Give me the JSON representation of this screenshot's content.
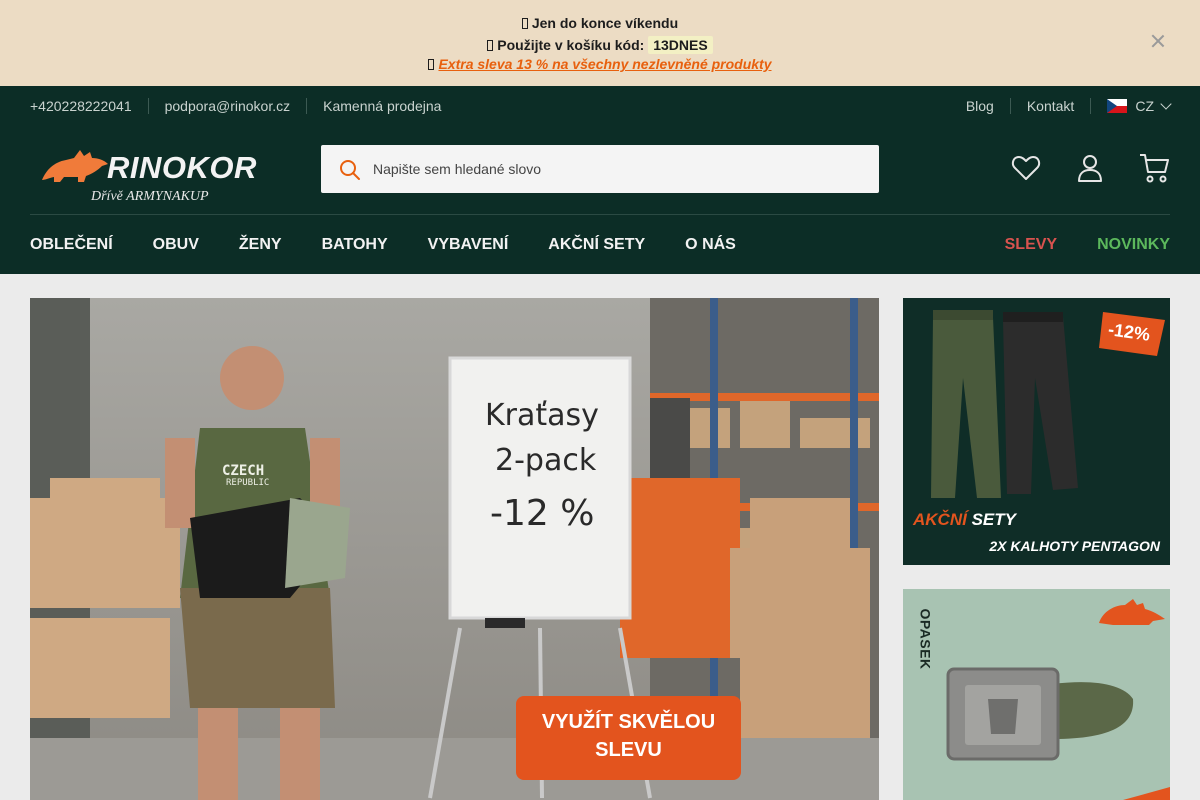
{
  "promo": {
    "line1": "Jen do konce víkendu",
    "line2_prefix": "Použijte v košíku kód:",
    "line2_code": "13DNES",
    "line3_link": "Extra sleva 13 % na všechny nezlevněné produkty"
  },
  "topbar": {
    "phone": "+420228222041",
    "email": "podpora@rinokor.cz",
    "store": "Kamenná prodejna",
    "blog": "Blog",
    "contact": "Kontakt",
    "lang": "CZ"
  },
  "logo": {
    "name": "RINOKOR",
    "tagline": "Dřívě ARMYNAKUP"
  },
  "search": {
    "placeholder": "Napište sem hledané slovo"
  },
  "nav": {
    "items": [
      "OBLEČENÍ",
      "OBUV",
      "ŽENY",
      "BATOHY",
      "VYBAVENÍ",
      "AKČNÍ SETY",
      "O NÁS"
    ],
    "sale": "SLEVY",
    "new": "NOVINKY"
  },
  "hero": {
    "shirt_line1": "CZECH",
    "shirt_line2": "REPUBLIC",
    "board_line1": "Kraťasy",
    "board_line2": "2-pack",
    "board_line3": "-12 %",
    "cta_line1": "VYUŽÍT SKVĚLOU",
    "cta_line2": "SLEVU"
  },
  "side_banner_1": {
    "badge": "-12%",
    "title_accent": "AKČNÍ",
    "title_rest": "SETY",
    "subtitle": "2X KALHOTY PENTAGON"
  },
  "side_banner_2": {
    "vertical_label": "OPASEK"
  },
  "colors": {
    "header_bg": "#0c2d26",
    "promo_bg": "#ecdcc4",
    "accent_orange": "#e8600e",
    "sale_red": "#d9534f",
    "new_green": "#5cb85c"
  }
}
